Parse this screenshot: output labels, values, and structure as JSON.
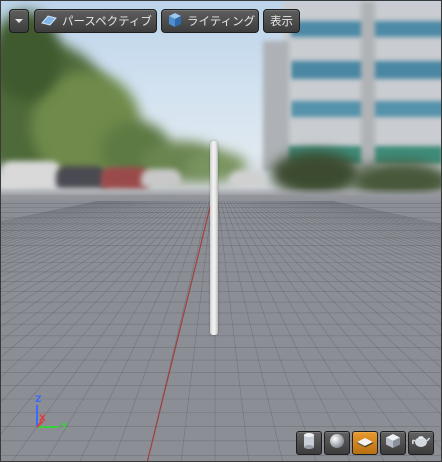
{
  "toolbar": {
    "options_menu": {
      "icon": "chevron-down-icon"
    },
    "view_mode": {
      "label": "パースペクティブ",
      "icon": "perspective-icon"
    },
    "lighting": {
      "label": "ライティング",
      "icon": "lighting-cube-icon"
    },
    "show": {
      "label": "表示"
    }
  },
  "axis_gizmo": {
    "x": "X",
    "y": "Y",
    "z": "Z"
  },
  "preview_shapes": [
    {
      "name": "cylinder",
      "icon": "cylinder-icon",
      "active": false
    },
    {
      "name": "sphere",
      "icon": "sphere-icon",
      "active": false
    },
    {
      "name": "plane",
      "icon": "plane-icon",
      "active": true
    },
    {
      "name": "cube",
      "icon": "cube-icon",
      "active": false
    },
    {
      "name": "custom-mesh",
      "icon": "teapot-icon",
      "active": false
    }
  ],
  "colors": {
    "accent_active": "#e08a1e",
    "axis_x": "#e23b3b",
    "axis_y": "#3ccf3c",
    "axis_z": "#3a6bff"
  }
}
